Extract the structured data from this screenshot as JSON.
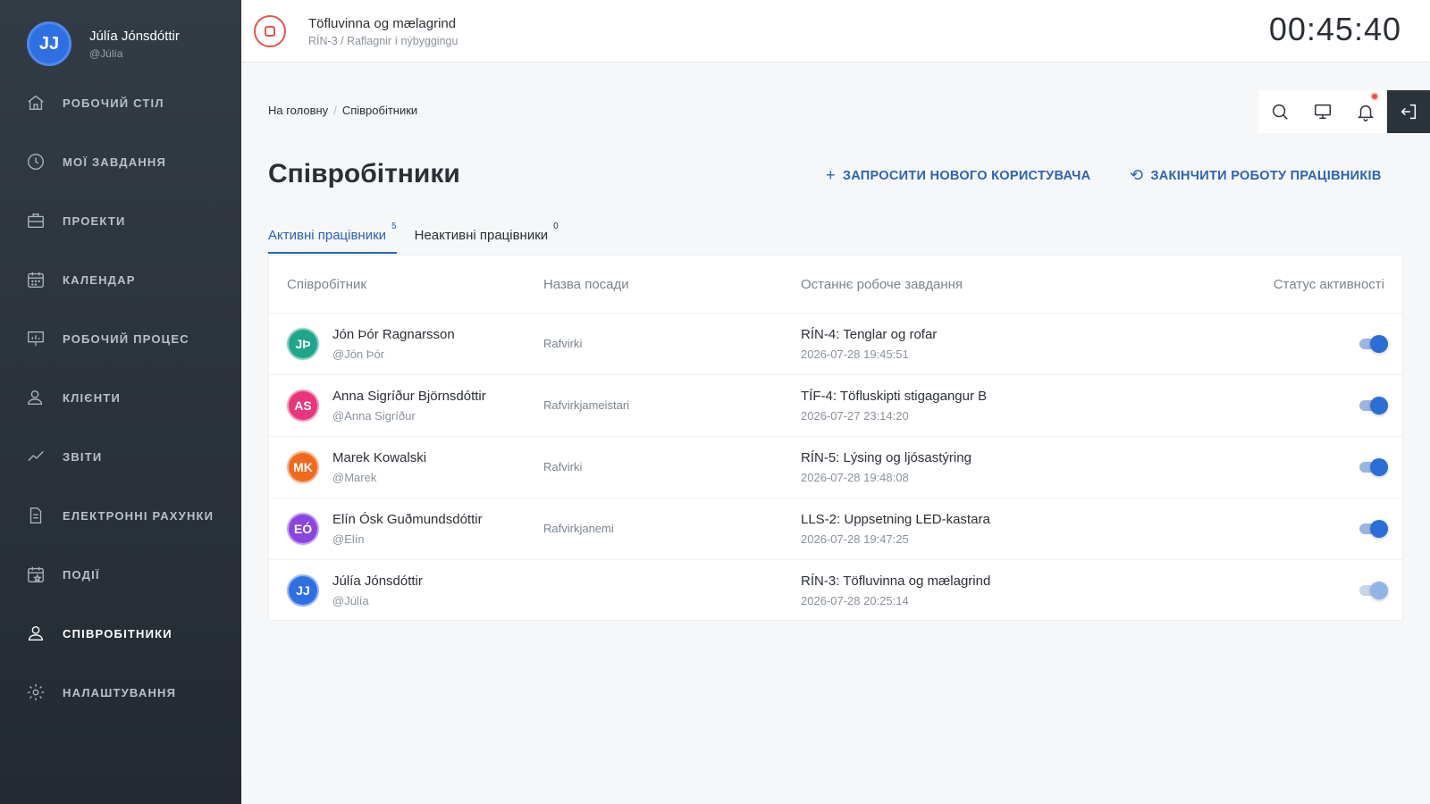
{
  "profile": {
    "initials": "JJ",
    "name": "Júlía Jónsdóttir",
    "handle": "@Júlía"
  },
  "nav": [
    {
      "label": "РОБОЧИЙ СТІЛ",
      "icon": "home-icon"
    },
    {
      "label": "МОЇ ЗАВДАННЯ",
      "icon": "clock-icon"
    },
    {
      "label": "ПРОЕКТИ",
      "icon": "briefcase-icon"
    },
    {
      "label": "КАЛЕНДАР",
      "icon": "calendar-icon"
    },
    {
      "label": "РОБОЧИЙ ПРОЦЕС",
      "icon": "presentation-icon"
    },
    {
      "label": "КЛІЄНТИ",
      "icon": "user-icon"
    },
    {
      "label": "ЗВІТИ",
      "icon": "chart-line-icon"
    },
    {
      "label": "ЕЛЕКТРОННІ РАХУНКИ",
      "icon": "document-icon"
    },
    {
      "label": "ПОДІЇ",
      "icon": "calendar-star-icon"
    },
    {
      "label": "СПІВРОБІТНИКИ",
      "icon": "users-icon",
      "active": true
    },
    {
      "label": "НАЛАШТУВАННЯ",
      "icon": "gear-icon"
    }
  ],
  "topbar": {
    "task_title": "Töfluvinna og mælagrind",
    "task_sub": "RÍN-3 / Raflagnir í nýbyggingu",
    "timer": "00:45:40"
  },
  "breadcrumb": {
    "home": "На головну",
    "sep": "/",
    "current": "Співробітники"
  },
  "page": {
    "title": "Співробітники",
    "invite_label": "ЗАПРОСИТИ НОВОГО КОРИСТУВАЧА",
    "end_label": "ЗАКІНЧИТИ РОБОТУ ПРАЦІВНИКІВ"
  },
  "tabs": [
    {
      "label": "Активні працівники",
      "count": "5",
      "active": true
    },
    {
      "label": "Неактивні працівники",
      "count": "0"
    }
  ],
  "table": {
    "headers": {
      "employee": "Співробітник",
      "job": "Назва посади",
      "last_task": "Останнє робоче завдання",
      "status": "Статус активності"
    },
    "rows": [
      {
        "initials": "JÞ",
        "color": "#1fa58a",
        "name": "Jón Þór Ragnarsson",
        "handle": "@Jón Þór",
        "job": "Rafvirki",
        "task": "RÍN-4: Tenglar og rofar",
        "time": "2026-07-28 19:45:51",
        "active": true
      },
      {
        "initials": "AS",
        "color": "#e8357b",
        "name": "Anna Sigríður Björnsdóttir",
        "handle": "@Anna Sigríður",
        "job": "Rafvirkjameistari",
        "task": "TÍF-4: Töfluskipti stigagangur B",
        "time": "2026-07-27 23:14:20",
        "active": true
      },
      {
        "initials": "MK",
        "color": "#f06a1d",
        "name": "Marek Kowalski",
        "handle": "@Marek",
        "job": "Rafvirki",
        "task": "RÍN-5: Lýsing og ljósastýring",
        "time": "2026-07-28 19:48:08",
        "active": true
      },
      {
        "initials": "EÓ",
        "color": "#8a44e0",
        "name": "Elín Ósk Guðmundsdóttir",
        "handle": "@Elín",
        "job": "Rafvirkjanemi",
        "task": "LLS-2: Uppsetning LED-kastara",
        "time": "2026-07-28 19:47:25",
        "active": true
      },
      {
        "initials": "JJ",
        "color": "#2f6fe4",
        "name": "Júlía Jónsdóttir",
        "handle": "@Júlía",
        "job": "",
        "task": "RÍN-3: Töfluvinna og mælagrind",
        "time": "2026-07-28 20:25:14",
        "active": true,
        "dim": true
      }
    ]
  }
}
